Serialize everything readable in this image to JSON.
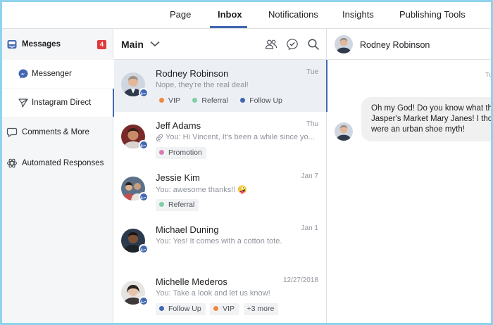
{
  "topnav": {
    "tabs": [
      "Page",
      "Inbox",
      "Notifications",
      "Insights",
      "Publishing Tools"
    ],
    "active": "Inbox"
  },
  "sidebar": {
    "messages": {
      "label": "Messages",
      "badge": "4"
    },
    "messenger": "Messenger",
    "instagram": "Instagram Direct",
    "comments": "Comments & More",
    "automated": "Automated Responses"
  },
  "list": {
    "title": "Main",
    "conversations": [
      {
        "name": "Rodney Robinson",
        "preview": "Nope, they're the real deal!",
        "date": "Tue",
        "tags": [
          {
            "label": "VIP",
            "color": "#f0883e"
          },
          {
            "label": "Referral",
            "color": "#7fcfa8"
          },
          {
            "label": "Follow Up",
            "color": "#4267b2"
          }
        ]
      },
      {
        "name": "Jeff Adams",
        "preview": "You: Hi Vincent, It's been a while since yo...",
        "date": "Thu",
        "tags": [
          {
            "label": "Promotion",
            "color": "#d979b5"
          }
        ]
      },
      {
        "name": "Jessie Kim",
        "preview": "You: awesome thanks!! 🤪",
        "date": "Jan 7",
        "tags": [
          {
            "label": "Referral",
            "color": "#7fcfa8"
          }
        ]
      },
      {
        "name": "Michael Duning",
        "preview": "You: Yes! It comes with a cotton tote.",
        "date": "Jan 1",
        "tags": []
      },
      {
        "name": "Michelle Mederos",
        "preview": "You: Take a look and let us know!",
        "date": "12/27/2018",
        "tags": [
          {
            "label": "Follow Up",
            "color": "#4267b2"
          },
          {
            "label": "VIP",
            "color": "#f0883e"
          }
        ],
        "more": "+3 more"
      }
    ]
  },
  "chat": {
    "name": "Rodney Robinson",
    "time": "Tu",
    "lines": [
      "Oh my God! Do you know what th",
      "Jasper's Market Mary Janes! I tho",
      "were an urban shoe myth!"
    ]
  },
  "icons": {
    "messages": "inbox-tray-icon",
    "messenger": "messenger-icon",
    "instagram": "send-arrow-icon",
    "comments": "speech-bubble-icon",
    "automated": "atom-icon",
    "header": [
      "assign-people-icon",
      "mark-done-icon",
      "search-icon"
    ]
  },
  "colors": {
    "accent": "#4267b2",
    "badge": "#e0393e",
    "selected_bg": "#eceff4"
  }
}
